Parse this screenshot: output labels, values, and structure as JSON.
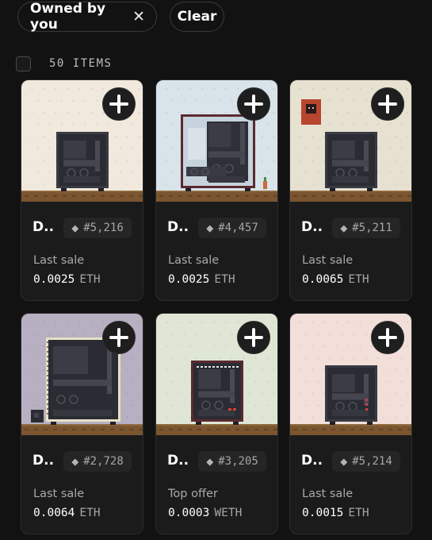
{
  "filters": {
    "owned_label": "Owned by you",
    "clear_label": "Clear"
  },
  "results": {
    "count_label": "50 ITEMS"
  },
  "icons": {
    "close": "close-icon",
    "add": "plus-icon",
    "eth": "eth-diamond-icon"
  },
  "colors": {
    "background": "#121212",
    "card": "#1b1b1b",
    "floor": "#7a5530"
  },
  "items": [
    {
      "name": "D..",
      "token": "#5,216",
      "eth_icon": "◆",
      "sale_label": "Last sale",
      "price": "0.0025",
      "currency": "ETH",
      "bg": "#f1e9dd"
    },
    {
      "name": "D..",
      "token": "#4,457",
      "eth_icon": "◆",
      "sale_label": "Last sale",
      "price": "0.0025",
      "currency": "ETH",
      "bg": "#d9e4ea"
    },
    {
      "name": "D..",
      "token": "#5,211",
      "eth_icon": "◆",
      "sale_label": "Last sale",
      "price": "0.0065",
      "currency": "ETH",
      "bg": "#e7e1d2"
    },
    {
      "name": "D..",
      "token": "#2,728",
      "eth_icon": "◆",
      "sale_label": "Last sale",
      "price": "0.0064",
      "currency": "ETH",
      "bg": "#b6b0c2"
    },
    {
      "name": "D..",
      "token": "#3,205",
      "eth_icon": "◆",
      "sale_label": "Top offer",
      "price": "0.0003",
      "currency": "WETH",
      "bg": "#dfe6d6"
    },
    {
      "name": "D..",
      "token": "#5,214",
      "eth_icon": "◆",
      "sale_label": "Last sale",
      "price": "0.0015",
      "currency": "ETH",
      "bg": "#f2dfda"
    }
  ]
}
